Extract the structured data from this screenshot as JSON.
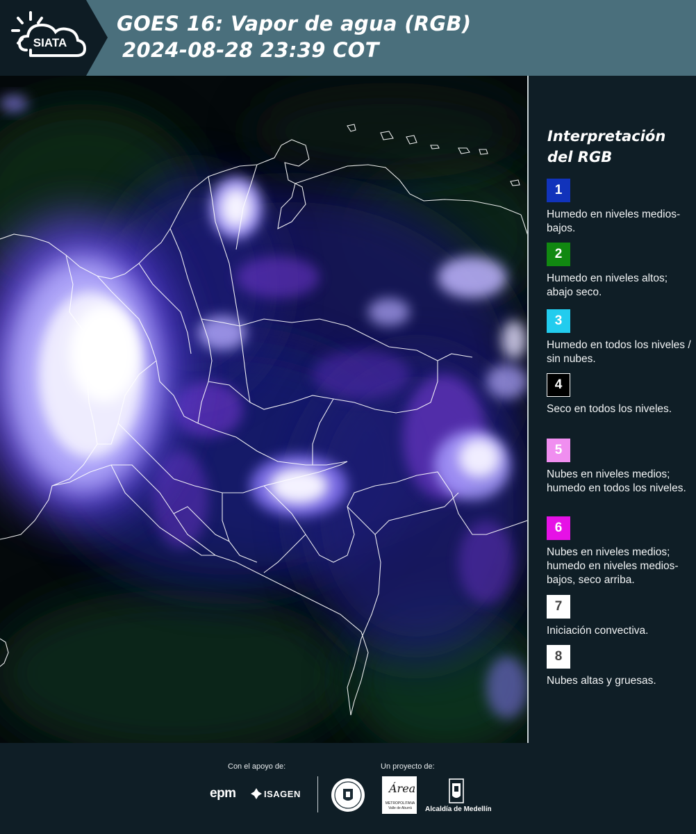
{
  "header": {
    "logo_text": "SIATA",
    "title": "GOES 16: Vapor de agua (RGB)",
    "subtitle": "2024-08-28 23:39 COT"
  },
  "map": {
    "icon": "satellite-rgb-map",
    "colors": {
      "background": "#050a0c",
      "borders": "#ffffff",
      "cloud_white": "#f4f4ff",
      "moist_blue": "#2a2ea8",
      "violet": "#8b3fe0",
      "green_tint": "#0f3a1c"
    }
  },
  "legend": {
    "title": "Interpretación del RGB",
    "items": [
      {
        "number": "1",
        "color": "#1133bb",
        "description": "Humedo en niveles medios-bajos."
      },
      {
        "number": "2",
        "color": "#118811",
        "description": "Humedo en niveles altos; abajo seco."
      },
      {
        "number": "3",
        "color": "#22ccee",
        "description": "Humedo en todos los niveles / sin nubes."
      },
      {
        "number": "4",
        "color": "#000000",
        "description": "Seco en todos los niveles."
      },
      {
        "number": "5",
        "color": "#f08ef0",
        "description": "Nubes en niveles medios; humedo en todos los niveles."
      },
      {
        "number": "6",
        "color": "#e611e6",
        "description": "Nubes en niveles medios; humedo en niveles medios-bajos, seco arriba."
      },
      {
        "number": "7",
        "color": "#ffffff",
        "description": "Iniciación convectiva."
      },
      {
        "number": "8",
        "color": "#ffffff",
        "description": "Nubes altas y gruesas."
      }
    ]
  },
  "footer": {
    "support_label": "Con el apoyo de:",
    "project_label": "Un proyecto de:",
    "epm_text": "epm",
    "isagen_text": "ISAGEN",
    "area_text": "Área",
    "area_small": "METROPOLITANA Valle de Aburrá",
    "medellin_text": "Alcaldía de Medellín"
  }
}
